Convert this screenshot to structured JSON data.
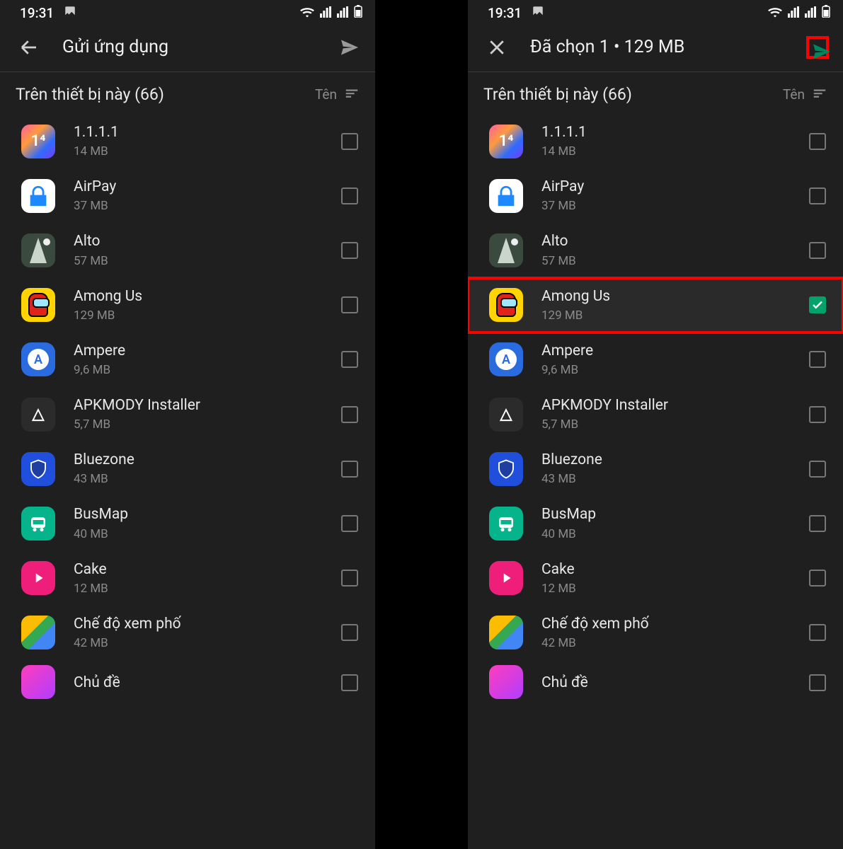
{
  "status": {
    "time": "19:31"
  },
  "left": {
    "title": "Gửi ứng dụng",
    "subheader": "Trên thiết bị này (66)",
    "sort_label": "Tên"
  },
  "right": {
    "title": "Đã chọn 1 • 129 MB",
    "subheader": "Trên thiết bị này (66)",
    "sort_label": "Tên"
  },
  "apps": [
    {
      "name": "1.1.1.1",
      "size": "14 MB",
      "icon": "ic-1111",
      "glyph": "1⁴"
    },
    {
      "name": "AirPay",
      "size": "37 MB",
      "icon": "ic-airpay"
    },
    {
      "name": "Alto",
      "size": "57 MB",
      "icon": "ic-alto"
    },
    {
      "name": "Among Us",
      "size": "129 MB",
      "icon": "ic-among"
    },
    {
      "name": "Ampere",
      "size": "9,6 MB",
      "icon": "ic-ampere",
      "glyph": "A"
    },
    {
      "name": "APKMODY Installer",
      "size": "5,7 MB",
      "icon": "ic-apk",
      "glyph": "△"
    },
    {
      "name": "Bluezone",
      "size": "43 MB",
      "icon": "ic-blue"
    },
    {
      "name": "BusMap",
      "size": "40 MB",
      "icon": "ic-bus"
    },
    {
      "name": "Cake",
      "size": "12 MB",
      "icon": "ic-cake"
    },
    {
      "name": "Chế độ xem phố",
      "size": "42 MB",
      "icon": "ic-street"
    },
    {
      "name": "Chủ đề",
      "size": "",
      "icon": "ic-theme"
    }
  ]
}
